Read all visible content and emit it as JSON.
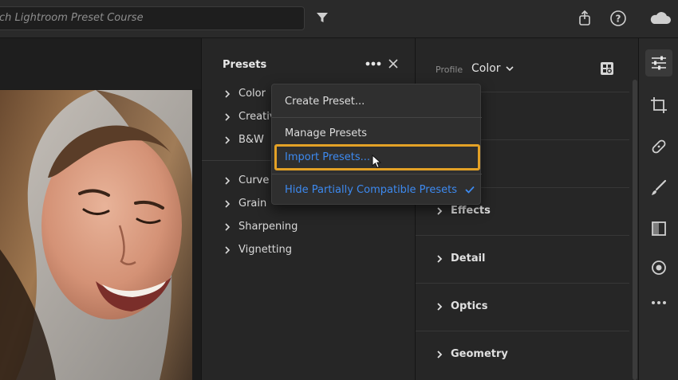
{
  "search": {
    "placeholder": "ch Lightroom Preset Course"
  },
  "icons": {
    "filter": "filter-icon",
    "share": "share-icon",
    "help": "help-icon",
    "cloud": "cloud-icon"
  },
  "presets_panel": {
    "title": "Presets",
    "groups_top": [
      "Color",
      "Creative",
      "B&W"
    ],
    "groups_bottom": [
      "Curve",
      "Grain",
      "Sharpening",
      "Vignetting"
    ]
  },
  "menu": {
    "items": [
      "Create Preset...",
      "Manage Presets",
      "Import Presets...",
      "Hide Partially Compatible Presets"
    ],
    "highlight_color": "#e3a126",
    "accent_color": "#3d8af0"
  },
  "edit_panel": {
    "profile_label": "Profile",
    "profile_value": "Color",
    "sections": [
      "Effects",
      "Detail",
      "Optics",
      "Geometry"
    ]
  },
  "tool_rail": [
    "edit-sliders-icon",
    "crop-icon",
    "healing-icon",
    "brush-icon",
    "gradient-icon",
    "radial-icon",
    "more-icon"
  ]
}
